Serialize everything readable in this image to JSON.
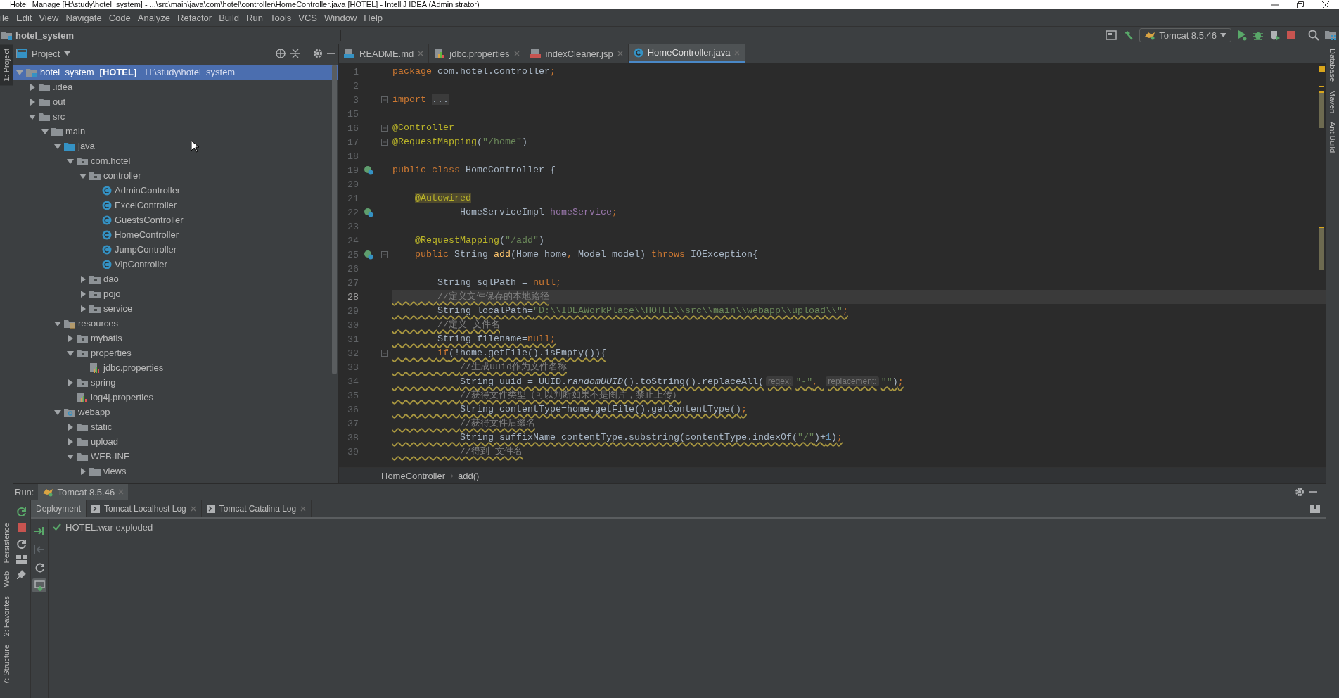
{
  "window": {
    "title": "Hotel_Manage [H:\\study\\hotel_system] - ...\\src\\main\\java\\com\\hotel\\controller\\HomeController.java [HOTEL] - IntelliJ IDEA (Administrator)"
  },
  "menu": [
    "ile",
    "Edit",
    "View",
    "Navigate",
    "Code",
    "Analyze",
    "Refactor",
    "Build",
    "Run",
    "Tools",
    "VCS",
    "Window",
    "Help"
  ],
  "navbar": {
    "project": "hotel_system",
    "run_config": "Tomcat 8.5.46"
  },
  "left_strip": [
    {
      "label": "1: Project",
      "selected": true
    },
    {
      "label": "Persistence",
      "selected": false
    },
    {
      "label": "Web",
      "selected": false
    },
    {
      "label": "2: Favorites",
      "selected": false
    },
    {
      "label": "7: Structure",
      "selected": false
    }
  ],
  "right_strip": [
    {
      "label": "Database",
      "selected": false
    },
    {
      "label": "Maven",
      "selected": false
    },
    {
      "label": "Ant Build",
      "selected": false
    }
  ],
  "project": {
    "title": "Project",
    "tree": [
      {
        "label": "hotel_system",
        "tag": "[HOTEL]",
        "path": "H:\\study\\hotel_system",
        "kind": "module",
        "expanded": true,
        "selected": true,
        "children": [
          {
            "label": ".idea",
            "kind": "folder",
            "expanded": false,
            "selected": false
          },
          {
            "label": "out",
            "kind": "folder",
            "expanded": false,
            "selected": false
          },
          {
            "label": "src",
            "kind": "folder",
            "expanded": true,
            "selected": false,
            "children": [
              {
                "label": "main",
                "kind": "folder",
                "expanded": true,
                "selected": false,
                "children": [
                  {
                    "label": "java",
                    "kind": "source",
                    "expanded": true,
                    "selected": false,
                    "children": [
                      {
                        "label": "com.hotel",
                        "kind": "package",
                        "expanded": true,
                        "selected": false,
                        "children": [
                          {
                            "label": "controller",
                            "kind": "package",
                            "expanded": true,
                            "selected": false,
                            "children": [
                              {
                                "label": "AdminController",
                                "kind": "class",
                                "selected": false
                              },
                              {
                                "label": "ExcelController",
                                "kind": "class",
                                "selected": false
                              },
                              {
                                "label": "GuestsController",
                                "kind": "class",
                                "selected": false
                              },
                              {
                                "label": "HomeController",
                                "kind": "class",
                                "selected": false
                              },
                              {
                                "label": "JumpController",
                                "kind": "class",
                                "selected": false
                              },
                              {
                                "label": "VipController",
                                "kind": "class",
                                "selected": false
                              }
                            ]
                          },
                          {
                            "label": "dao",
                            "kind": "package",
                            "expanded": false,
                            "selected": false
                          },
                          {
                            "label": "pojo",
                            "kind": "package",
                            "expanded": false,
                            "selected": false
                          },
                          {
                            "label": "service",
                            "kind": "package",
                            "expanded": false,
                            "selected": false
                          }
                        ]
                      }
                    ]
                  },
                  {
                    "label": "resources",
                    "kind": "resources",
                    "expanded": true,
                    "selected": false,
                    "children": [
                      {
                        "label": "mybatis",
                        "kind": "package",
                        "expanded": false,
                        "selected": false
                      },
                      {
                        "label": "properties",
                        "kind": "package",
                        "expanded": true,
                        "selected": false,
                        "children": [
                          {
                            "label": "jdbc.properties",
                            "kind": "properties",
                            "selected": false
                          }
                        ]
                      },
                      {
                        "label": "spring",
                        "kind": "package",
                        "expanded": false,
                        "selected": false
                      },
                      {
                        "label": "log4j.properties",
                        "kind": "properties",
                        "selected": false
                      }
                    ]
                  },
                  {
                    "label": "webapp",
                    "kind": "web",
                    "expanded": true,
                    "selected": false,
                    "children": [
                      {
                        "label": "static",
                        "kind": "folder",
                        "expanded": false,
                        "selected": false
                      },
                      {
                        "label": "upload",
                        "kind": "folder",
                        "expanded": false,
                        "selected": false
                      },
                      {
                        "label": "WEB-INF",
                        "kind": "folder",
                        "expanded": true,
                        "selected": false,
                        "children": [
                          {
                            "label": "views",
                            "kind": "folder",
                            "expanded": false,
                            "selected": false
                          }
                        ]
                      }
                    ]
                  }
                ]
              }
            ]
          }
        ]
      }
    ]
  },
  "editor": {
    "tabs": [
      {
        "label": "README.md",
        "kind": "markdown",
        "selected": false
      },
      {
        "label": "jdbc.properties",
        "kind": "properties",
        "selected": false
      },
      {
        "label": "indexCleaner.jsp",
        "kind": "jsp",
        "selected": false
      },
      {
        "label": "HomeController.java",
        "kind": "class",
        "selected": true
      }
    ],
    "lines": [
      {
        "number": "1",
        "gutter": false,
        "fold": false,
        "current": false,
        "warning": false,
        "tokens": [
          {
            "text": "package ",
            "kind": "kw"
          },
          {
            "text": "com.hotel.controller",
            "kind": "plain"
          },
          {
            "text": ";",
            "kind": "kw"
          }
        ]
      },
      {
        "number": "2",
        "gutter": false,
        "fold": false,
        "current": false,
        "warning": false
      },
      {
        "number": "3",
        "gutter": false,
        "fold": true,
        "current": false,
        "warning": false,
        "tokens": [
          {
            "text": "import ",
            "kind": "kw"
          },
          {
            "text": "...",
            "kind": "folded"
          }
        ]
      },
      {
        "number": "15",
        "gutter": false,
        "fold": false,
        "current": false,
        "warning": false
      },
      {
        "number": "16",
        "gutter": false,
        "fold": true,
        "current": false,
        "warning": false,
        "tokens": [
          {
            "text": "@Controller",
            "kind": "ann"
          }
        ]
      },
      {
        "number": "17",
        "gutter": false,
        "fold": true,
        "current": false,
        "warning": false,
        "tokens": [
          {
            "text": "@RequestMapping",
            "kind": "ann"
          },
          {
            "text": "(",
            "kind": "plain"
          },
          {
            "text": "\"/home\"",
            "kind": "str"
          },
          {
            "text": ")",
            "kind": "plain"
          }
        ]
      },
      {
        "number": "18",
        "gutter": false,
        "fold": false,
        "current": false,
        "warning": false
      },
      {
        "number": "19",
        "gutter": true,
        "fold": false,
        "current": false,
        "warning": false,
        "tokens": [
          {
            "text": "public class ",
            "kind": "kw"
          },
          {
            "text": "HomeController {",
            "kind": "plain"
          }
        ]
      },
      {
        "number": "20",
        "gutter": false,
        "fold": false,
        "current": false,
        "warning": false
      },
      {
        "number": "21",
        "gutter": false,
        "fold": false,
        "current": false,
        "warning": false,
        "tokens": [
          {
            "text": "    @Autowired",
            "kind": "annhl"
          }
        ]
      },
      {
        "number": "22",
        "gutter": true,
        "fold": false,
        "current": false,
        "warning": false,
        "tokens": [
          {
            "text": "            HomeServiceImpl ",
            "kind": "plain"
          },
          {
            "text": "homeService",
            "kind": "field"
          },
          {
            "text": ";",
            "kind": "kw"
          }
        ]
      },
      {
        "number": "23",
        "gutter": false,
        "fold": false,
        "current": false,
        "warning": false
      },
      {
        "number": "24",
        "gutter": false,
        "fold": false,
        "current": false,
        "warning": false,
        "tokens": [
          {
            "text": "    @RequestMapping",
            "kind": "ann"
          },
          {
            "text": "(",
            "kind": "plain"
          },
          {
            "text": "\"/add\"",
            "kind": "str"
          },
          {
            "text": ")",
            "kind": "plain"
          }
        ]
      },
      {
        "number": "25",
        "gutter": true,
        "fold": true,
        "current": false,
        "warning": false,
        "tokens": [
          {
            "text": "    public ",
            "kind": "kw"
          },
          {
            "text": "String ",
            "kind": "plain"
          },
          {
            "text": "add",
            "kind": "method"
          },
          {
            "text": "(Home home",
            "kind": "plain"
          },
          {
            "text": ", ",
            "kind": "kw"
          },
          {
            "text": "Model model) ",
            "kind": "plain"
          },
          {
            "text": "throws ",
            "kind": "kw"
          },
          {
            "text": "IOException{",
            "kind": "plain"
          }
        ]
      },
      {
        "number": "26",
        "gutter": false,
        "fold": false,
        "current": false,
        "warning": false
      },
      {
        "number": "27",
        "gutter": false,
        "fold": false,
        "current": false,
        "warning": false,
        "tokens": [
          {
            "text": "        String sqlPath = ",
            "kind": "plain"
          },
          {
            "text": "null",
            "kind": "kw"
          },
          {
            "text": ";",
            "kind": "kw"
          }
        ]
      },
      {
        "number": "28",
        "gutter": false,
        "fold": false,
        "current": true,
        "warning": true,
        "tokens": [
          {
            "text": "        //定义文件保存的本地路径",
            "kind": "cmt"
          }
        ]
      },
      {
        "number": "29",
        "gutter": false,
        "fold": false,
        "current": false,
        "warning": true,
        "tokens": [
          {
            "text": "        String localPath=",
            "kind": "plain"
          },
          {
            "text": "\"D:\\\\IDEAWorkPlace\\\\HOTEL\\\\src\\\\main\\\\webapp\\\\upload\\\\\"",
            "kind": "str"
          },
          {
            "text": ";",
            "kind": "kw"
          }
        ]
      },
      {
        "number": "30",
        "gutter": false,
        "fold": false,
        "current": false,
        "warning": true,
        "tokens": [
          {
            "text": "        //定义 文件名",
            "kind": "cmt"
          }
        ]
      },
      {
        "number": "31",
        "gutter": false,
        "fold": false,
        "current": false,
        "warning": true,
        "tokens": [
          {
            "text": "        String filename=",
            "kind": "plain"
          },
          {
            "text": "null",
            "kind": "kw"
          },
          {
            "text": ";",
            "kind": "kw"
          }
        ]
      },
      {
        "number": "32",
        "gutter": false,
        "fold": true,
        "current": false,
        "warning": true,
        "tokens": [
          {
            "text": "        if",
            "kind": "kw"
          },
          {
            "text": "(!home.getFile().isEmpty()){",
            "kind": "plain"
          }
        ]
      },
      {
        "number": "33",
        "gutter": false,
        "fold": false,
        "current": false,
        "warning": true,
        "tokens": [
          {
            "text": "            //生成uuid作为文件名称",
            "kind": "cmt"
          }
        ]
      },
      {
        "number": "34",
        "gutter": false,
        "fold": false,
        "current": false,
        "warning": true,
        "tokens": [
          {
            "text": "            String uuid = UUID.",
            "kind": "plain"
          },
          {
            "text": "randomUUID",
            "kind": "italic"
          },
          {
            "text": "().toString().replaceAll(",
            "kind": "plain"
          },
          {
            "text": "regex:",
            "kind": "hint"
          },
          {
            "text": "\"-\"",
            "kind": "str"
          },
          {
            "text": ", ",
            "kind": "kw"
          },
          {
            "text": "replacement:",
            "kind": "hint"
          },
          {
            "text": "\"\"",
            "kind": "str"
          },
          {
            "text": ")",
            "kind": "plain"
          },
          {
            "text": ";",
            "kind": "kw"
          }
        ]
      },
      {
        "number": "35",
        "gutter": false,
        "fold": false,
        "current": false,
        "warning": true,
        "tokens": [
          {
            "text": "            //获得文件类型（可以判断如果不是图片，禁止上传）",
            "kind": "cmt"
          }
        ]
      },
      {
        "number": "36",
        "gutter": false,
        "fold": false,
        "current": false,
        "warning": true,
        "tokens": [
          {
            "text": "            String contentType=home.getFile().getContentType()",
            "kind": "plain"
          },
          {
            "text": ";",
            "kind": "kw"
          }
        ]
      },
      {
        "number": "37",
        "gutter": false,
        "fold": false,
        "current": false,
        "warning": true,
        "tokens": [
          {
            "text": "            //获得文件后缀名",
            "kind": "cmt"
          }
        ]
      },
      {
        "number": "38",
        "gutter": false,
        "fold": false,
        "current": false,
        "warning": true,
        "tokens": [
          {
            "text": "            String suffixName=contentType.substring(contentType.indexOf(",
            "kind": "plain"
          },
          {
            "text": "\"/\"",
            "kind": "str"
          },
          {
            "text": ")+",
            "kind": "plain"
          },
          {
            "text": "1",
            "kind": "num"
          },
          {
            "text": ")",
            "kind": "plain"
          },
          {
            "text": ";",
            "kind": "kw"
          }
        ]
      },
      {
        "number": "39",
        "gutter": false,
        "fold": false,
        "current": false,
        "warning": true,
        "tokens": [
          {
            "text": "            //得到 文件名",
            "kind": "cmt"
          }
        ]
      }
    ],
    "breadcrumb": [
      "HomeController",
      "add()"
    ]
  },
  "run": {
    "label": "Run:",
    "config_tab": "Tomcat 8.5.46",
    "tabs": [
      {
        "label": "Deployment",
        "kind": "deployment",
        "selected": true
      },
      {
        "label": "Tomcat Localhost Log",
        "kind": "log",
        "selected": false
      },
      {
        "label": "Tomcat Catalina Log",
        "kind": "log",
        "selected": false
      }
    ],
    "actions": [
      {
        "disabled": false,
        "pressed": false
      },
      {
        "disabled": true,
        "pressed": false
      },
      {
        "disabled": false,
        "pressed": false
      },
      {
        "disabled": false,
        "pressed": true
      }
    ],
    "artifacts": [
      {
        "label": "HOTEL:war exploded",
        "deployed": true
      }
    ]
  }
}
